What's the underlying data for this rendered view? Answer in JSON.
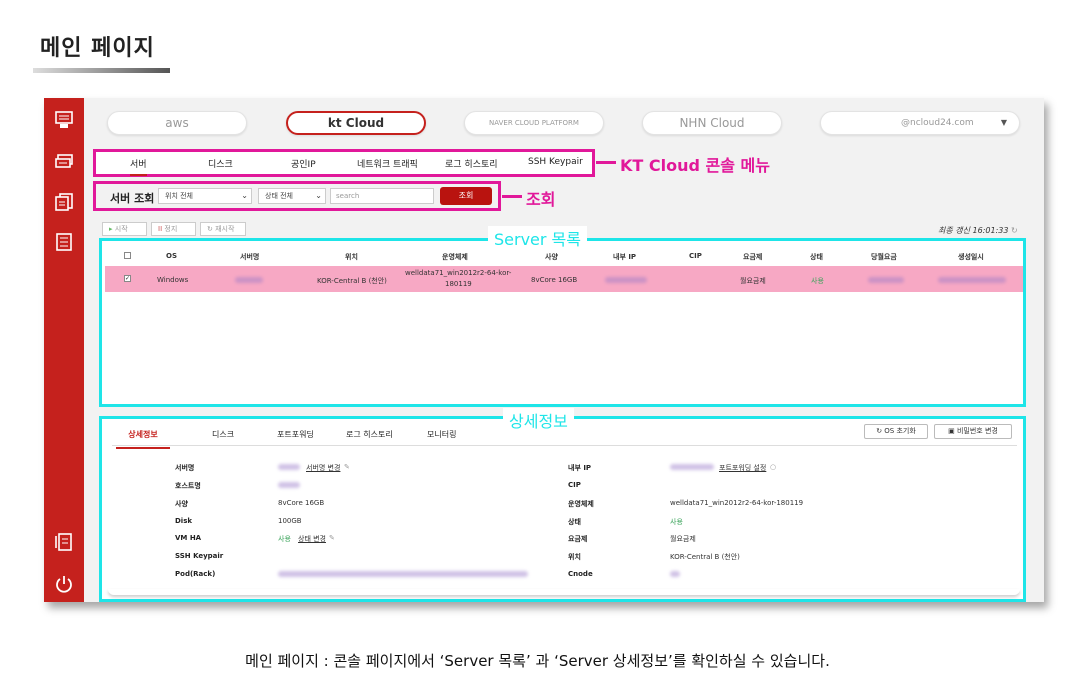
{
  "page": {
    "title": "메인 페이지",
    "caption": "메인 페이지 : 콘솔 페이지에서 ‘Server 목록’ 과 ‘Server 상세정보’를 확인하실 수 있습니다."
  },
  "sidebar": {
    "icons": [
      "server-icon",
      "chat-icon",
      "documents-icon",
      "list-icon",
      "receipt-icon",
      "power-icon"
    ]
  },
  "cloud_selector": {
    "aws": "aws",
    "kt": "kt Cloud",
    "naver": "NAVER CLOUD PLATFORM",
    "nhn": "NHN Cloud",
    "account": "@ncloud24.com"
  },
  "annotations": {
    "menu": "KT Cloud 콘솔 메뉴",
    "search": "조회",
    "server_list": "Server 목록",
    "details": "상세정보"
  },
  "menu": [
    "서버",
    "디스크",
    "공인IP",
    "네트워크 트래픽",
    "로그 히스토리",
    "SSH Keypair"
  ],
  "search": {
    "label": "서버 조회",
    "location": "위치 전체",
    "status": "상태 전체",
    "placeholder": "search",
    "button": "조회"
  },
  "controls": {
    "start": "시작",
    "stop": "정지",
    "restart": "재시작",
    "last_update": "최종 갱신 16:01:33"
  },
  "server_table": {
    "headers": [
      "OS",
      "서버명",
      "위치",
      "운영체제",
      "사양",
      "내부 IP",
      "CIP",
      "요금제",
      "상태",
      "당월요금",
      "생성일시"
    ],
    "row": {
      "os": "Windows",
      "location": "KOR-Central B (천안)",
      "os_image_line1": "welldata71_win2012r2-64-kor-",
      "os_image_line2": "180119",
      "spec": "8vCore 16GB",
      "plan": "월요금제",
      "status": "사용"
    }
  },
  "details": {
    "tabs": [
      "상세정보",
      "디스크",
      "포트포워딩",
      "로그 히스토리",
      "모니터링"
    ],
    "buttons": {
      "os_reset": "OS 초기화",
      "password_change": "비밀번호 변경"
    },
    "left": {
      "labels": [
        "서버명",
        "호스트명",
        "사양",
        "Disk",
        "VM HA",
        "SSH Keypair",
        "Pod(Rack)"
      ],
      "server_name_link": "서버명 변경",
      "spec": "8vCore 16GB",
      "disk": "100GB",
      "vmha_status": "사용",
      "vmha_link": "상태 변경"
    },
    "right": {
      "labels": [
        "내부 IP",
        "CIP",
        "운영체제",
        "상태",
        "요금제",
        "위치",
        "Cnode"
      ],
      "portforward_link": "포트포워딩 설정",
      "os": "welldata71_win2012r2-64-kor-180119",
      "status": "사용",
      "plan": "월요금제",
      "location": "KOR-Central B (천안)"
    }
  }
}
